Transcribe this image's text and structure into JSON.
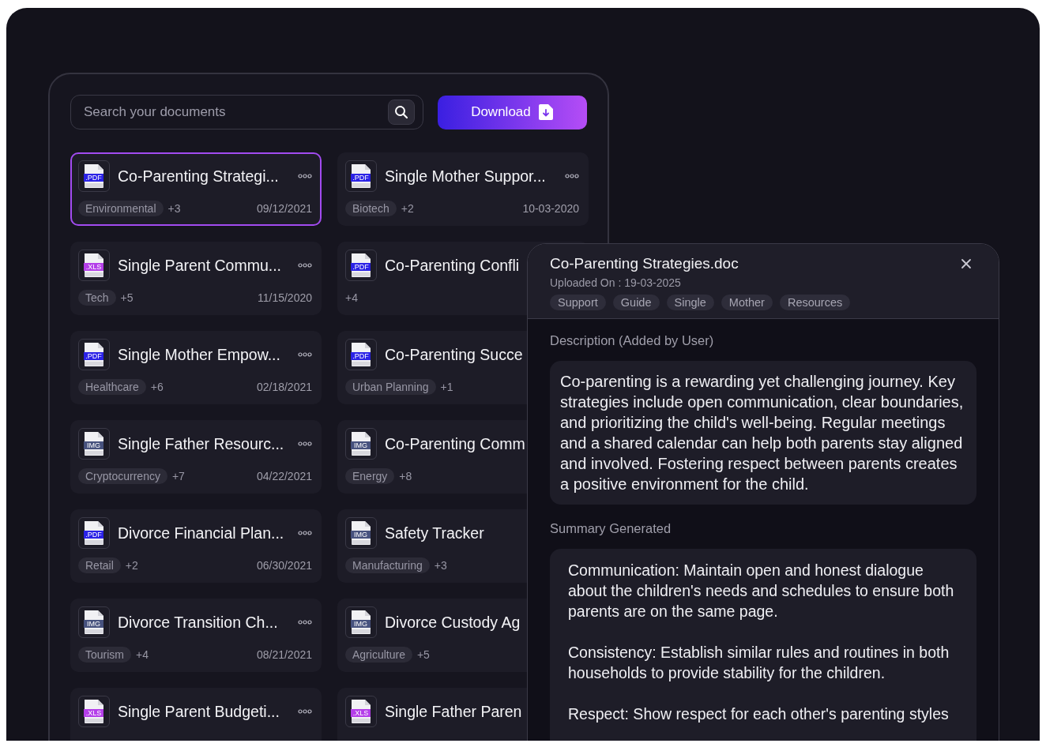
{
  "search": {
    "placeholder": "Search your documents"
  },
  "download_button": {
    "label": "Download"
  },
  "documents": [
    {
      "title": "Co-Parenting Strategi...",
      "color": "#2b22e6",
      "type_label": ".PDF",
      "tag": "Environmental",
      "more": "+3",
      "date": "09/12/2021",
      "menu": true,
      "selected": true
    },
    {
      "title": "Single Mother Suppor...",
      "color": "#2b22e6",
      "type_label": ".PDF",
      "tag": "Biotech",
      "more": "+2",
      "date": "10-03-2020",
      "menu": true,
      "selected": false
    },
    {
      "title": "Single Parent Commu...",
      "color": "#b43ee9",
      "type_label": ".XLS",
      "tag": "Tech",
      "more": "+5",
      "date": "11/15/2020",
      "menu": true,
      "selected": false
    },
    {
      "title": "Co-Parenting Confli",
      "color": "#2b22e6",
      "type_label": ".PDF",
      "more": "+4",
      "menu": false,
      "selected": false
    },
    {
      "title": "Single Mother Empow...",
      "color": "#2b22e6",
      "type_label": ".PDF",
      "tag": "Healthcare",
      "more": "+6",
      "date": "02/18/2021",
      "menu": true,
      "selected": false
    },
    {
      "title": "Co-Parenting Succe",
      "color": "#2b22e6",
      "type_label": ".PDF",
      "tag": "Urban Planning",
      "more": "+1",
      "menu": false,
      "selected": false
    },
    {
      "title": "Single Father Resourc...",
      "color": "#47527e",
      "type_label": "IMG",
      "tag": "Cryptocurrency",
      "more": "+7",
      "date": "04/22/2021",
      "menu": true,
      "selected": false
    },
    {
      "title": "Co-Parenting Comm",
      "color": "#47527e",
      "type_label": "IMG",
      "tag": "Energy",
      "more": "+8",
      "menu": false,
      "selected": false
    },
    {
      "title": "Divorce Financial Plan...",
      "color": "#2b22e6",
      "type_label": ".PDF",
      "tag": "Retail",
      "more": "+2",
      "date": "06/30/2021",
      "menu": true,
      "selected": false
    },
    {
      "title": "Safety Tracker",
      "color": "#47527e",
      "type_label": "IMG",
      "tag": "Manufacturing",
      "more": "+3",
      "menu": false,
      "selected": false
    },
    {
      "title": "Divorce Transition Ch...",
      "color": "#47527e",
      "type_label": "IMG",
      "tag": "Tourism",
      "more": "+4",
      "date": "08/21/2021",
      "menu": true,
      "selected": false
    },
    {
      "title": "Divorce Custody Ag",
      "color": "#47527e",
      "type_label": "IMG",
      "tag": "Agriculture",
      "more": "+5",
      "menu": false,
      "selected": false
    },
    {
      "title": "Single Parent Budgeti...",
      "color": "#b43ee9",
      "type_label": ".XLS",
      "menu": true,
      "selected": false
    },
    {
      "title": "Single Father Paren",
      "color": "#b43ee9",
      "type_label": ".XLS",
      "menu": false,
      "selected": false
    }
  ],
  "detail": {
    "title": "Co-Parenting Strategies.doc",
    "uploaded": "Uploaded On : 19-03-2025",
    "tags": [
      "Support",
      "Guide",
      "Single",
      "Mother",
      "Resources"
    ],
    "description_heading": "Description (Added by User)",
    "description": "Co-parenting is a rewarding yet challenging journey. Key strategies include open communication, clear boundaries, and prioritizing the child's well-being. Regular meetings and a shared calendar can help both parents stay aligned and involved. Fostering respect between parents creates a positive environment for the child.",
    "summary_heading": "Summary Generated",
    "summary": [
      "Communication: Maintain open and honest dialogue about the children's needs and schedules to ensure both parents are on the same page.",
      "Consistency: Establish similar rules and routines in both households to provide stability for the children.",
      "Respect: Show respect for each other's parenting styles"
    ]
  }
}
